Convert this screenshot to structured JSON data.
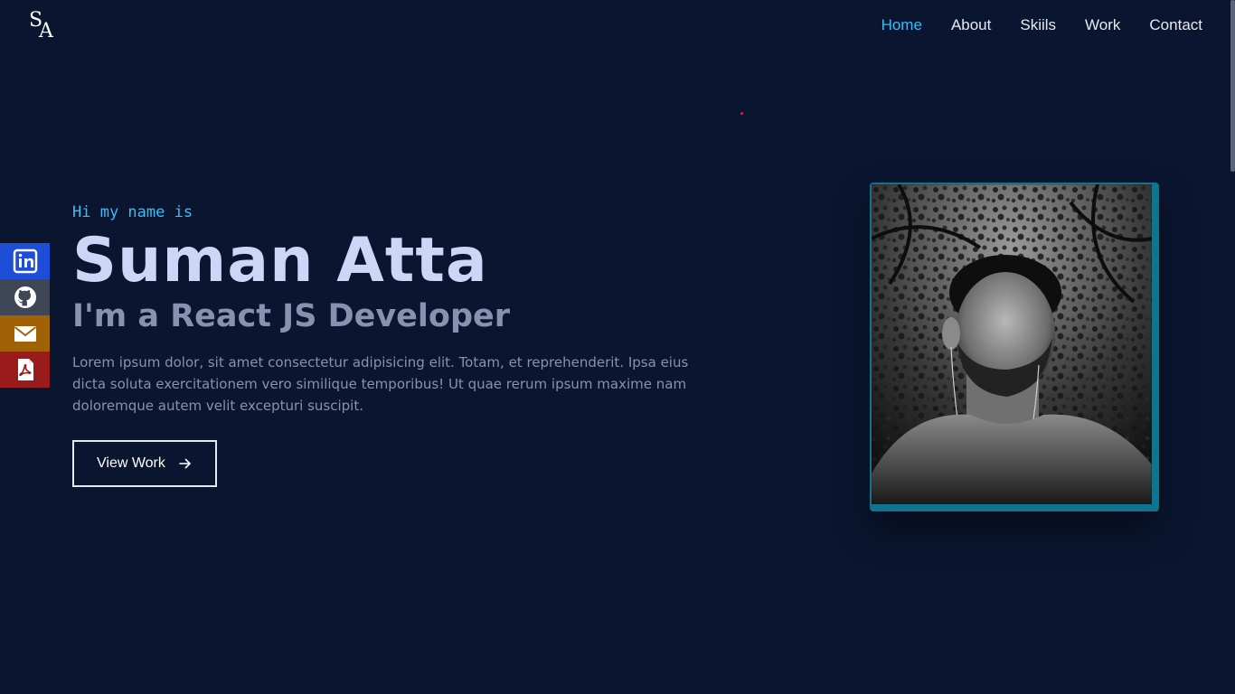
{
  "logo": {
    "line1": "S",
    "line2": "A"
  },
  "nav": {
    "items": [
      {
        "label": "Home"
      },
      {
        "label": "About"
      },
      {
        "label": "Skiils"
      },
      {
        "label": "Work"
      },
      {
        "label": "Contact"
      }
    ],
    "active_color": "#38bdf8"
  },
  "social": {
    "items": [
      {
        "icon": "linkedin-icon",
        "color": "#1d4ed8"
      },
      {
        "icon": "github-icon",
        "color": "#3f4756"
      },
      {
        "icon": "mail-icon",
        "color": "#a16207"
      },
      {
        "icon": "pdf-icon",
        "color": "#991b1b"
      }
    ]
  },
  "hero": {
    "greeting": "Hi my name is",
    "name": "Suman Atta",
    "role": "I'm a React JS Developer",
    "description": "Lorem ipsum dolor, sit amet consectetur adipisicing elit. Totam, et reprehenderit. Ipsa eius dicta soluta exercitationem vero similique temporibus! Ut quae rerum ipsum maxime nam doloremque autem velit excepturi suscipit.",
    "button_label": "View Work"
  },
  "colors": {
    "background": "#0a1630",
    "accent": "#38bdf8",
    "frame": "#0e7490"
  }
}
